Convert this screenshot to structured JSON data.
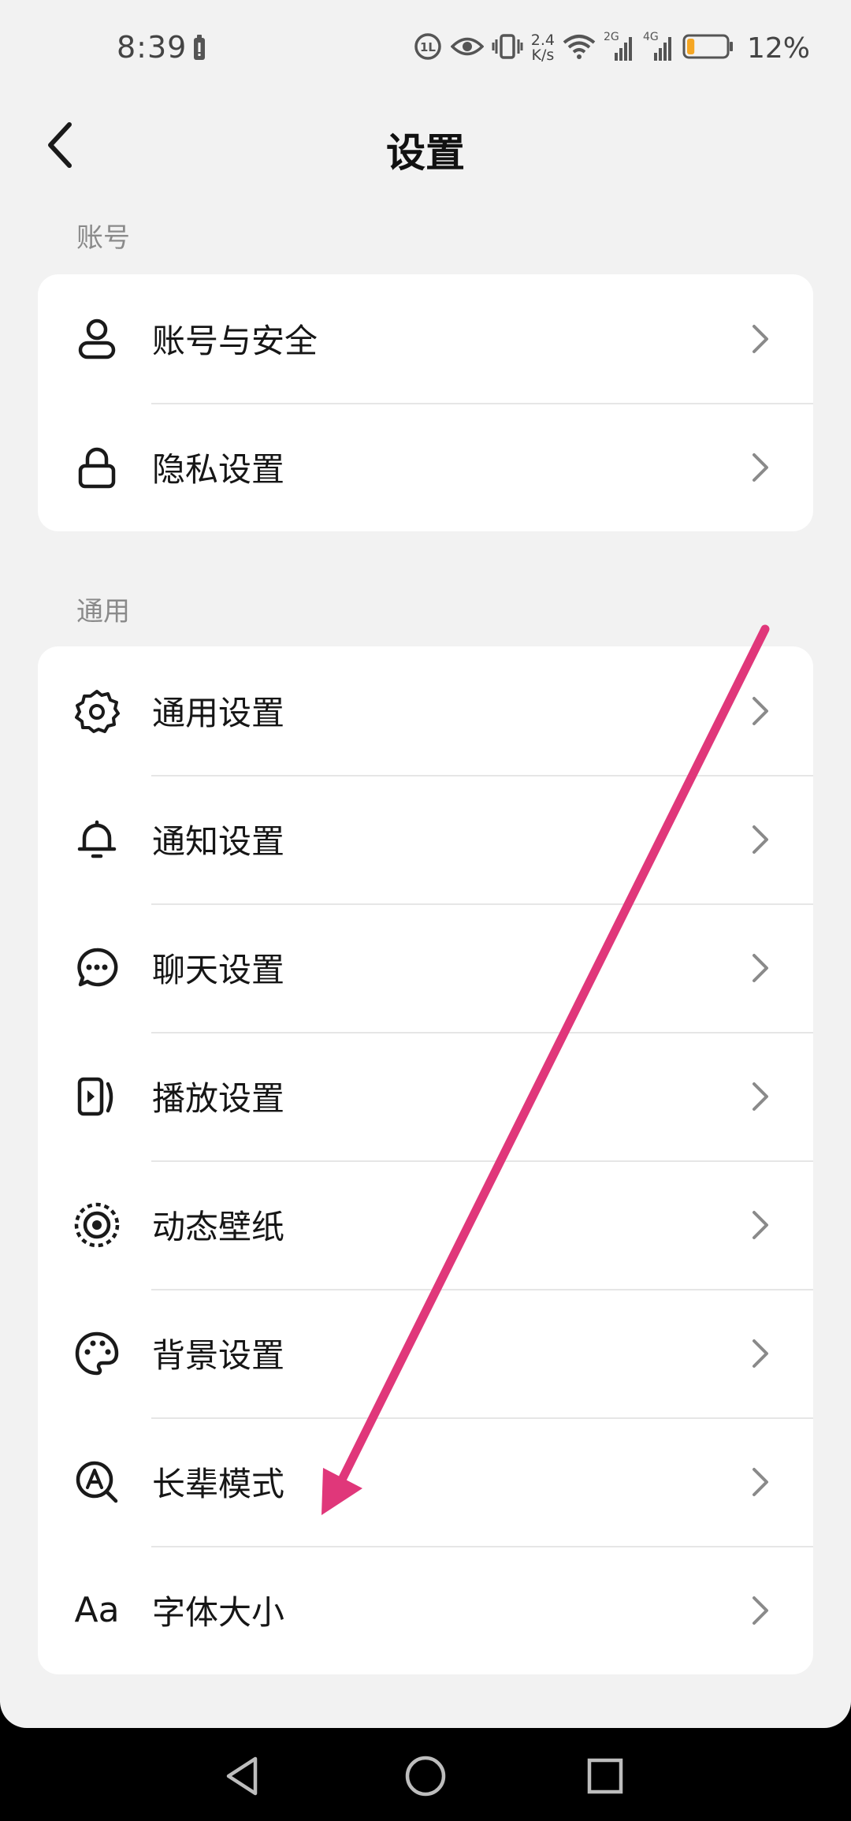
{
  "status_bar": {
    "time": "8:39",
    "net_speed_value": "2.4",
    "net_speed_unit": "K/s",
    "signal_1_label": "2G",
    "signal_2_label": "4G",
    "battery_percent": "12%",
    "battery_level": 0.12,
    "battery_color": "#f5a623"
  },
  "header": {
    "title": "设置",
    "back_icon": "chevron-left-icon"
  },
  "sections": [
    {
      "label": "账号",
      "items": [
        {
          "label": "账号与安全",
          "icon": "person-icon"
        },
        {
          "label": "隐私设置",
          "icon": "lock-icon"
        }
      ]
    },
    {
      "label": "通用",
      "items": [
        {
          "label": "通用设置",
          "icon": "gear-icon"
        },
        {
          "label": "通知设置",
          "icon": "bell-icon"
        },
        {
          "label": "聊天设置",
          "icon": "chat-bubble-icon"
        },
        {
          "label": "播放设置",
          "icon": "play-icon"
        },
        {
          "label": "动态壁纸",
          "icon": "live-wallpaper-icon"
        },
        {
          "label": "背景设置",
          "icon": "palette-icon"
        },
        {
          "label": "长辈模式",
          "icon": "elder-mode-icon"
        },
        {
          "label": "字体大小",
          "icon": "font-size-icon",
          "icon_text": "Aa"
        }
      ]
    }
  ],
  "navigation": {
    "back": "triangle-back-icon",
    "home": "circle-home-icon",
    "recents": "square-recents-icon"
  },
  "annotation": {
    "color": "#e0377a",
    "points_to": "长辈模式"
  }
}
